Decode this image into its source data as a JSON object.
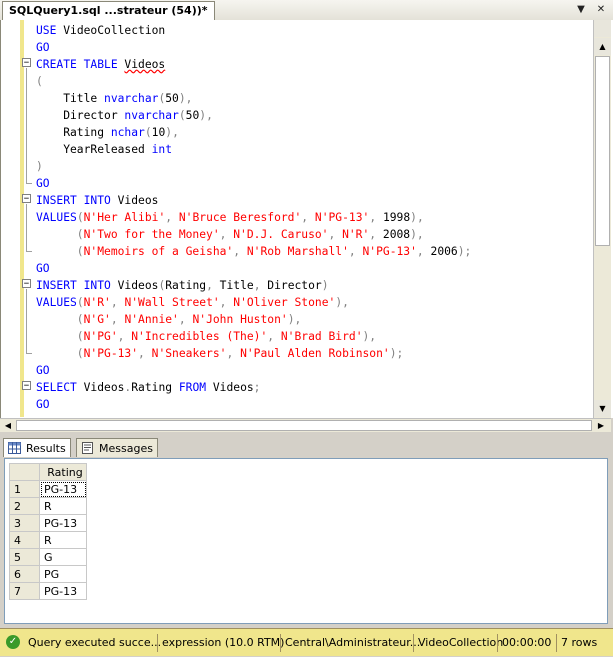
{
  "document_tab": {
    "title": "SQLQuery1.sql ...strateur (54))*"
  },
  "tabbar_buttons": {
    "dropdown": "▼",
    "close": "✕"
  },
  "code": {
    "l1a": "USE ",
    "l1b": "VideoCollection",
    "l2": "GO",
    "l3a": "CREATE TABLE ",
    "l3b": "Videos",
    "l4": "(",
    "l5a": "    Title ",
    "l5b": "nvarchar",
    "l5c": "(",
    "l5d": "50",
    "l5e": "),",
    "l6a": "    Director ",
    "l6b": "nvarchar",
    "l6c": "(",
    "l6d": "50",
    "l6e": "),",
    "l7a": "    Rating ",
    "l7b": "nchar",
    "l7c": "(",
    "l7d": "10",
    "l7e": "),",
    "l8a": "    YearReleased ",
    "l8b": "int",
    "l9": ")",
    "l10": "GO",
    "l11a": "INSERT INTO ",
    "l11b": "Videos",
    "l12a": "VALUES",
    "l12b": "(",
    "l12c": "N'Her Alibi'",
    "l12d": ", ",
    "l12e": "N'Bruce Beresford'",
    "l12f": ", ",
    "l12g": "N'PG-13'",
    "l12h": ", ",
    "l12i": "1998",
    "l12j": "),",
    "l13a": "      (",
    "l13b": "N'Two for the Money'",
    "l13c": ", ",
    "l13d": "N'D.J. Caruso'",
    "l13e": ", ",
    "l13f": "N'R'",
    "l13g": ", ",
    "l13h": "2008",
    "l13i": "),",
    "l14a": "      (",
    "l14b": "N'Memoirs of a Geisha'",
    "l14c": ", ",
    "l14d": "N'Rob Marshall'",
    "l14e": ", ",
    "l14f": "N'PG-13'",
    "l14g": ", ",
    "l14h": "2006",
    "l14i": ");",
    "l15": "GO",
    "l16a": "INSERT INTO ",
    "l16b": "Videos",
    "l16c": "(",
    "l16d": "Rating",
    "l16e": ", ",
    "l16f": "Title",
    "l16g": ", ",
    "l16h": "Director",
    "l16i": ")",
    "l17a": "VALUES",
    "l17b": "(",
    "l17c": "N'R'",
    "l17d": ", ",
    "l17e": "N'Wall Street'",
    "l17f": ", ",
    "l17g": "N'Oliver Stone'",
    "l17h": "),",
    "l18a": "      (",
    "l18b": "N'G'",
    "l18c": ", ",
    "l18d": "N'Annie'",
    "l18e": ", ",
    "l18f": "N'John Huston'",
    "l18g": "),",
    "l19a": "      (",
    "l19b": "N'PG'",
    "l19c": ", ",
    "l19d": "N'Incredibles (The)'",
    "l19e": ", ",
    "l19f": "N'Brad Bird'",
    "l19g": "),",
    "l20a": "      (",
    "l20b": "N'PG-13'",
    "l20c": ", ",
    "l20d": "N'Sneakers'",
    "l20e": ", ",
    "l20f": "N'Paul Alden Robinson'",
    "l20g": ");",
    "l21": "GO",
    "l22a": "SELECT ",
    "l22b": "Videos",
    "l22c": ".",
    "l22d": "Rating",
    "l22e": " FROM ",
    "l22f": "Videos",
    "l22g": ";",
    "l23": "GO"
  },
  "results_tabs": {
    "results": "Results",
    "messages": "Messages"
  },
  "grid": {
    "column": "Rating",
    "rows": [
      {
        "n": "1",
        "v": "PG-13"
      },
      {
        "n": "2",
        "v": "R"
      },
      {
        "n": "3",
        "v": "PG-13"
      },
      {
        "n": "4",
        "v": "R"
      },
      {
        "n": "5",
        "v": "G"
      },
      {
        "n": "6",
        "v": "PG"
      },
      {
        "n": "7",
        "v": "PG-13"
      }
    ]
  },
  "status": {
    "message": "Query executed succe...",
    "server": "expression (10.0 RTM)",
    "user": "Central\\Administrateur...",
    "database": "VideoCollection",
    "elapsed": "00:00:00",
    "rows": "7 rows"
  },
  "colors": {
    "keyword": "#0000ff",
    "string": "#ff0000",
    "gray": "#808080",
    "status_bar": "#f0e68c"
  }
}
